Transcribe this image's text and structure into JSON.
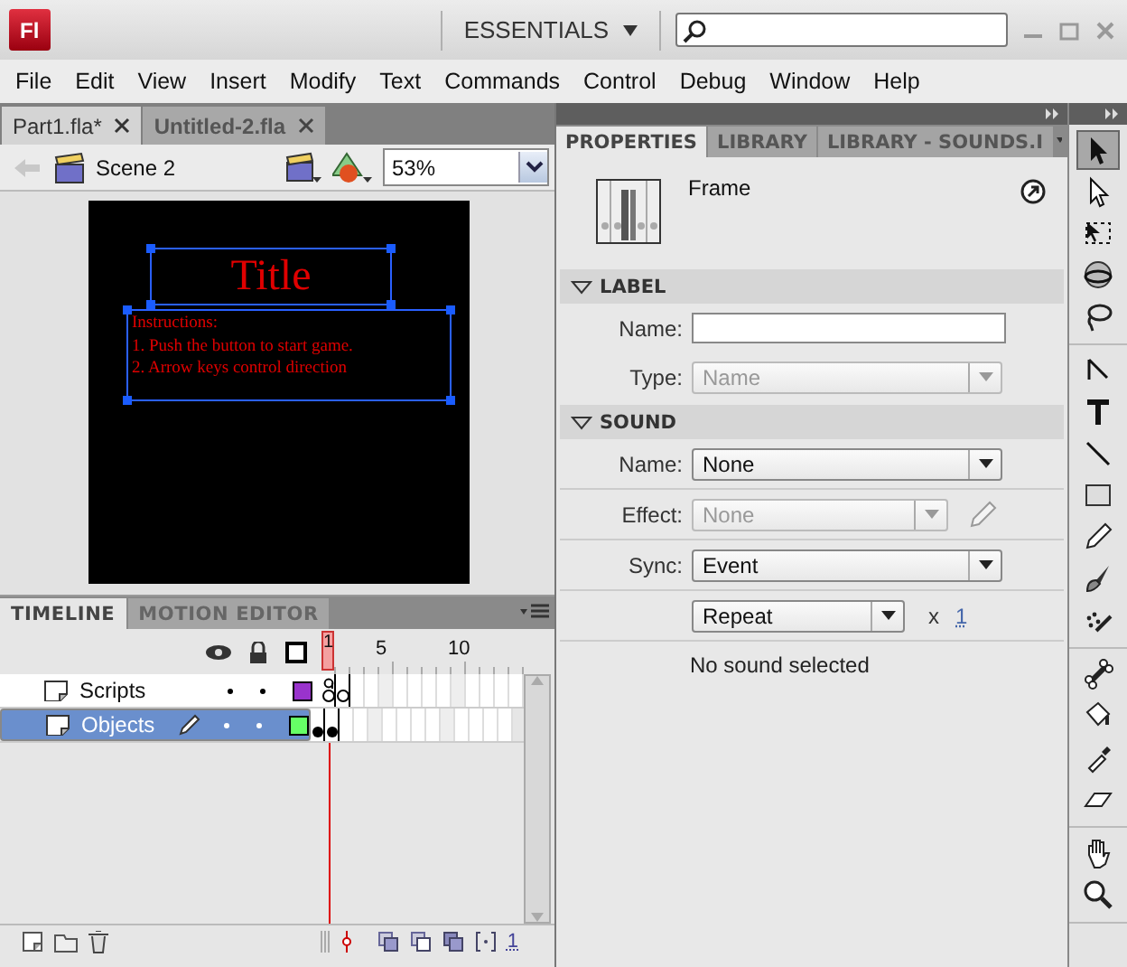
{
  "app": {
    "logo": "Fl",
    "workspace": "ESSENTIALS"
  },
  "menu": [
    "File",
    "Edit",
    "View",
    "Insert",
    "Modify",
    "Text",
    "Commands",
    "Control",
    "Debug",
    "Window",
    "Help"
  ],
  "document_tabs": [
    {
      "label": "Part1.fla*",
      "selected": true
    },
    {
      "label": "Untitled-2.fla",
      "selected": false
    }
  ],
  "edit_bar": {
    "scene": "Scene 2",
    "zoom": "53%"
  },
  "stage": {
    "title": "Title",
    "instructions": [
      "Instructions:",
      "1. Push the button to start game.",
      "2. Arrow keys control direction"
    ]
  },
  "timeline": {
    "tabs": [
      {
        "label": "TIMELINE",
        "selected": true
      },
      {
        "label": "MOTION EDITOR",
        "selected": false
      }
    ],
    "frame_numbers": [
      "1",
      "5",
      "10"
    ],
    "layers": [
      {
        "name": "Scripts",
        "selected": false,
        "visible": true,
        "locked": false,
        "color": "#9933cc",
        "frames": [
          {
            "kind": "empty",
            "script": true
          },
          {
            "kind": "empty"
          }
        ]
      },
      {
        "name": "Objects",
        "selected": true,
        "visible": true,
        "locked": false,
        "color": "#66ff66",
        "frames": [
          {
            "kind": "filled"
          },
          {
            "kind": "filled"
          }
        ]
      }
    ],
    "current_frame": "1"
  },
  "properties": {
    "tabs": [
      {
        "label": "PROPERTIES",
        "selected": true
      },
      {
        "label": "LIBRARY",
        "selected": false
      },
      {
        "label": "LIBRARY - SOUNDS.I",
        "selected": false
      }
    ],
    "type": "Frame",
    "sections": [
      {
        "title": "LABEL",
        "expanded": true,
        "rows": [
          {
            "kind": "text",
            "label": "Name:"
          },
          {
            "kind": "select",
            "label": "Type:",
            "value": "Name",
            "disabled": true
          }
        ]
      },
      {
        "title": "SOUND",
        "expanded": true,
        "rows": [
          {
            "kind": "select",
            "label": "Name:",
            "value": "None",
            "disabled": false
          },
          {
            "kind": "select",
            "label": "Effect:",
            "value": "None",
            "disabled": true,
            "edit": true
          },
          {
            "kind": "select",
            "label": "Sync:",
            "value": "Event",
            "disabled": false
          },
          {
            "kind": "repeat",
            "value": "Repeat",
            "sign": "x",
            "count": "1"
          },
          {
            "kind": "note",
            "text": "No sound selected"
          }
        ]
      }
    ]
  },
  "tools": [
    [
      {
        "kind": "selection",
        "selected": true
      },
      {
        "kind": "subselection",
        "selected": false
      },
      {
        "kind": "free-transform",
        "selected": false
      },
      {
        "kind": "rotation",
        "selected": false
      },
      {
        "kind": "lasso",
        "selected": false
      }
    ],
    [
      {
        "kind": "pen",
        "selected": false
      },
      {
        "kind": "text",
        "selected": false
      },
      {
        "kind": "line",
        "selected": false
      },
      {
        "kind": "rectangle",
        "selected": false
      },
      {
        "kind": "pencil",
        "selected": false
      },
      {
        "kind": "brush",
        "selected": false
      },
      {
        "kind": "spray",
        "selected": false
      }
    ],
    [
      {
        "kind": "bone",
        "selected": false
      },
      {
        "kind": "bucket",
        "selected": false
      },
      {
        "kind": "eyedropper",
        "selected": false
      },
      {
        "kind": "eraser",
        "selected": false
      }
    ],
    [
      {
        "kind": "hand",
        "selected": false
      },
      {
        "kind": "zoom",
        "selected": false
      }
    ]
  ]
}
